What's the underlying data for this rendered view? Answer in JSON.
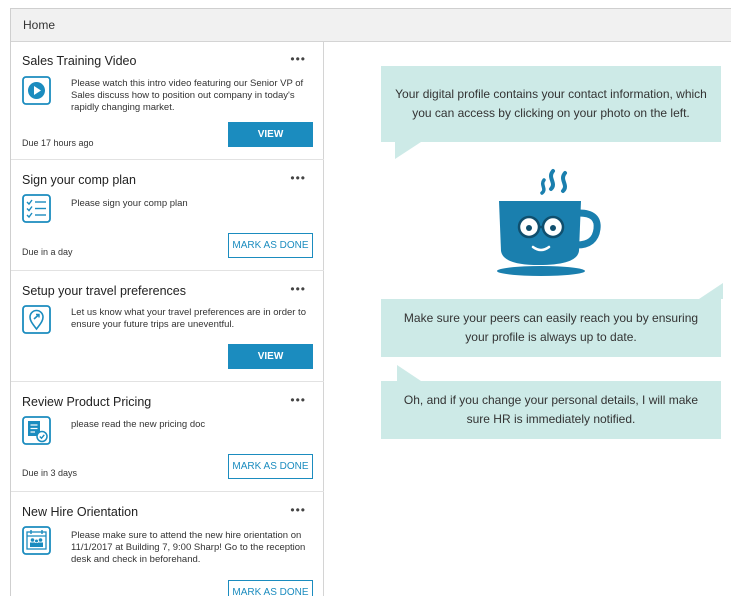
{
  "header": {
    "title": "Home"
  },
  "cards": [
    {
      "title": "Sales Training Video",
      "more": "•••",
      "icon": "play-icon",
      "description": "Please watch this intro video featuring our Senior VP of Sales discuss how to position out company in today's rapidly changing market.",
      "due": "Due 17 hours ago",
      "action": "VIEW"
    },
    {
      "title": "Sign your comp plan",
      "more": "•••",
      "icon": "checklist-icon",
      "description": "Please sign your comp plan",
      "due": "Due in a day",
      "action": "MARK AS DONE"
    },
    {
      "title": "Setup your travel preferences",
      "more": "•••",
      "icon": "location-icon",
      "description": "Let us know what your travel preferences are in order to ensure your future trips are uneventful.",
      "due": "",
      "action": "VIEW"
    },
    {
      "title": "Review Product Pricing",
      "more": "•••",
      "icon": "document-check-icon",
      "description": "please read the new pricing doc",
      "due": "Due in 3 days",
      "action": "MARK AS DONE"
    },
    {
      "title": "New Hire Orientation",
      "more": "•••",
      "icon": "calendar-people-icon",
      "description": "Please make sure to attend the new hire orientation on 11/1/2017 at Building 7, 9:00 Sharp! Go to the reception desk and check in beforehand.",
      "due": "",
      "action": "MARK AS DONE"
    }
  ],
  "assistant": {
    "mascot": "coffee-cup-mascot-icon",
    "messages": [
      "Your digital profile contains your contact information, which you can access by clicking on your photo on the left.",
      "Make sure your peers can easily reach you by ensuring your profile is always up to date.",
      "Oh, and if you change your personal details, I will make sure HR is immediately notified."
    ]
  },
  "colors": {
    "accent": "#1b8cbf",
    "bubble": "#cdeae7",
    "mascot": "#1a7fae"
  }
}
